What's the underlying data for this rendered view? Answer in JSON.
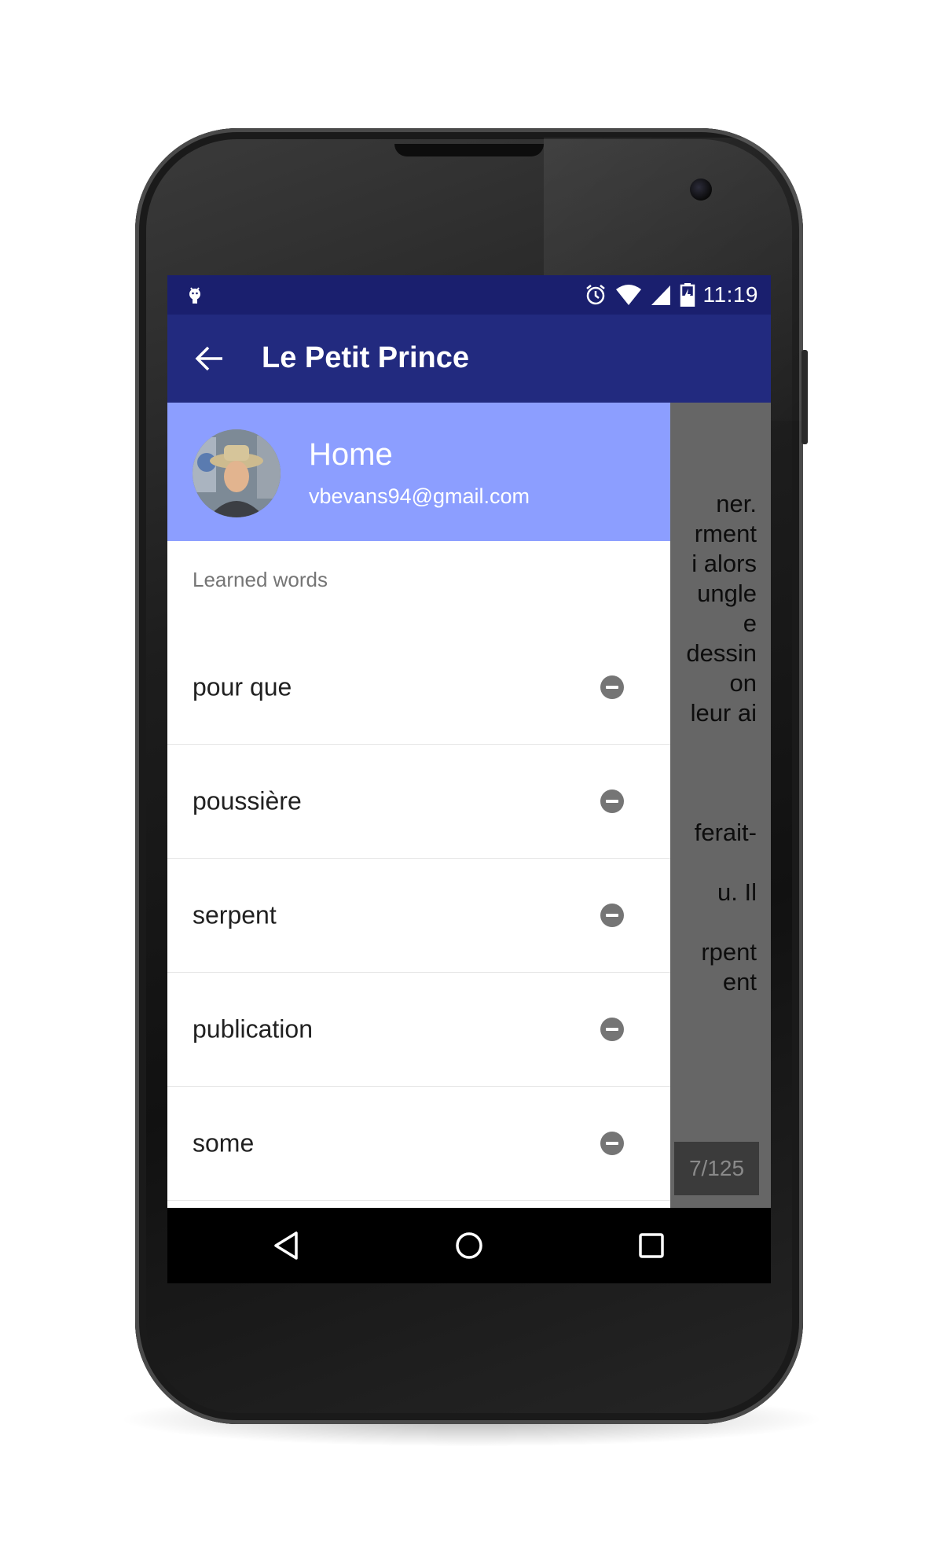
{
  "status_bar": {
    "time": "11:19",
    "left_icon": "android-debug-icon",
    "icons": [
      "alarm-icon",
      "wifi-icon",
      "signal-icon",
      "battery-charging-icon"
    ]
  },
  "toolbar": {
    "back_icon": "back-arrow-icon",
    "title": "Le Petit Prince"
  },
  "drawer": {
    "header": {
      "name": "Home",
      "email": "vbevans94@gmail.com"
    },
    "section_label": "Learned words",
    "words": [
      {
        "label": "pour que"
      },
      {
        "label": "poussière"
      },
      {
        "label": "serpent"
      },
      {
        "label": "publication"
      },
      {
        "label": "some"
      }
    ]
  },
  "book": {
    "visible_fragments": [
      "ner.",
      "rment",
      "i alors",
      "ungle",
      "e",
      "dessin",
      "on",
      "leur ai",
      "",
      "",
      "",
      "ferait-",
      "",
      "u. Il",
      "",
      "rpent",
      "ent"
    ],
    "page_indicator": "7/125"
  },
  "nav_bar": {
    "icons": [
      "back-triangle-icon",
      "home-circle-icon",
      "recents-square-icon"
    ]
  },
  "colors": {
    "status_bar": "#1a1f6e",
    "toolbar": "#222a7f",
    "drawer_header": "#8c9eff",
    "remove_icon": "#757575"
  }
}
